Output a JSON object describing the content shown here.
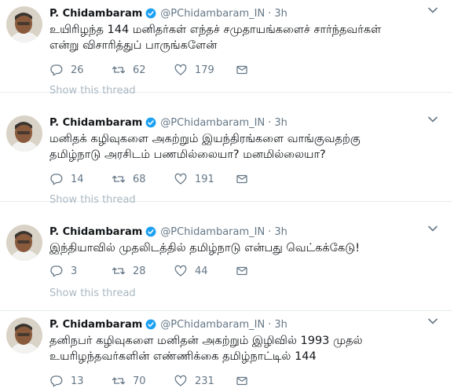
{
  "tweets": [
    {
      "name": "P. Chidambaram",
      "handle": "@PChidambaram_IN",
      "time": "3h",
      "text_line1": "உயிரிழந்த 144 மனிதர்கள் எந்தச் சமுதாயங்களைச் சார்ந்தவர்கள்",
      "text_line2": "என்று விசாரித்துப் பாருங்களேன்",
      "replies": "26",
      "retweets": "62",
      "likes": "179",
      "show_thread": "Show this thread"
    },
    {
      "name": "P. Chidambaram",
      "handle": "@PChidambaram_IN",
      "time": "3h",
      "text_line1": "மனிதக் கழிவுகளை அகற்றும் இயந்திரங்களை வாங்குவதற்கு",
      "text_line2": "தமிழ்நாடு அரசிடம் பணமில்லையா? மனமில்லையா?",
      "replies": "14",
      "retweets": "68",
      "likes": "191",
      "show_thread": "Show this thread"
    },
    {
      "name": "P. Chidambaram",
      "handle": "@PChidambaram_IN",
      "time": "3h",
      "text_line1": "இந்தியாவில் முதலிடத்தில் தமிழ்நாடு என்பது வெட்கக்கேடு!",
      "text_line2": "",
      "replies": "3",
      "retweets": "28",
      "likes": "44",
      "show_thread": "Show this thread"
    },
    {
      "name": "P. Chidambaram",
      "handle": "@PChidambaram_IN",
      "time": "3h",
      "text_line1": "தனிநபர் கழிவுகளை மனிதன் அகற்றும் இழிவில் 1993 முதல்",
      "text_line2": "உயரிழந்தவர்களின் எண்ணிக்கை தமிழ்நாட்டில் 144",
      "replies": "13",
      "retweets": "70",
      "likes": "231",
      "show_thread": ""
    }
  ],
  "icons": {
    "verified": "verified-badge-icon",
    "caret": "chevron-down-icon",
    "reply": "reply-icon",
    "retweet": "retweet-icon",
    "like": "heart-icon",
    "dm": "envelope-icon"
  },
  "colors": {
    "verified_blue": "#1da1f2",
    "muted": "#657786",
    "faint": "#aab8c2"
  }
}
